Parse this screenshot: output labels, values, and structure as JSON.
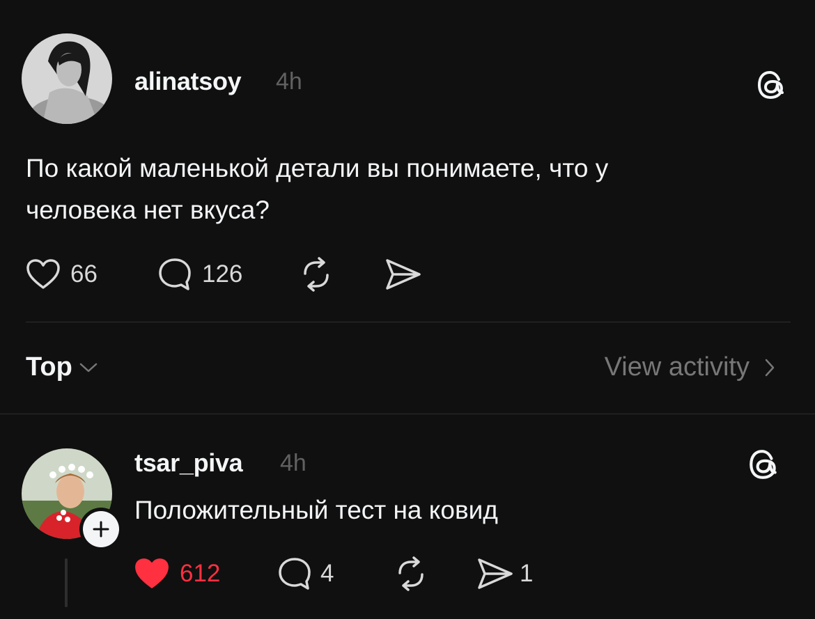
{
  "post": {
    "username": "alinatsoy",
    "time": "4h",
    "text_line1": "По какой маленькой детали вы понимаете, что у",
    "text_line2": "человека нет вкуса?",
    "likes": "66",
    "replies": "126",
    "avatar_icon": "avatar-photo-woman"
  },
  "sort": {
    "label": "Top",
    "view_activity": "View activity"
  },
  "reply": {
    "username": "tsar_piva",
    "time": "4h",
    "text": "Положительный тест на ковид",
    "likes": "612",
    "replies": "4",
    "shares": "1",
    "liked": true,
    "avatar_icon": "avatar-photo-man-flower-crown"
  },
  "colors": {
    "background": "#101010",
    "text": "#f3f5f7",
    "muted": "#616161",
    "like_red": "#ff3040",
    "divider": "#2e2e2e"
  },
  "icons": [
    "threads-icon",
    "heart-icon",
    "comment-icon",
    "repost-icon",
    "share-icon",
    "chevron-down-icon",
    "chevron-right-icon",
    "plus-icon"
  ]
}
